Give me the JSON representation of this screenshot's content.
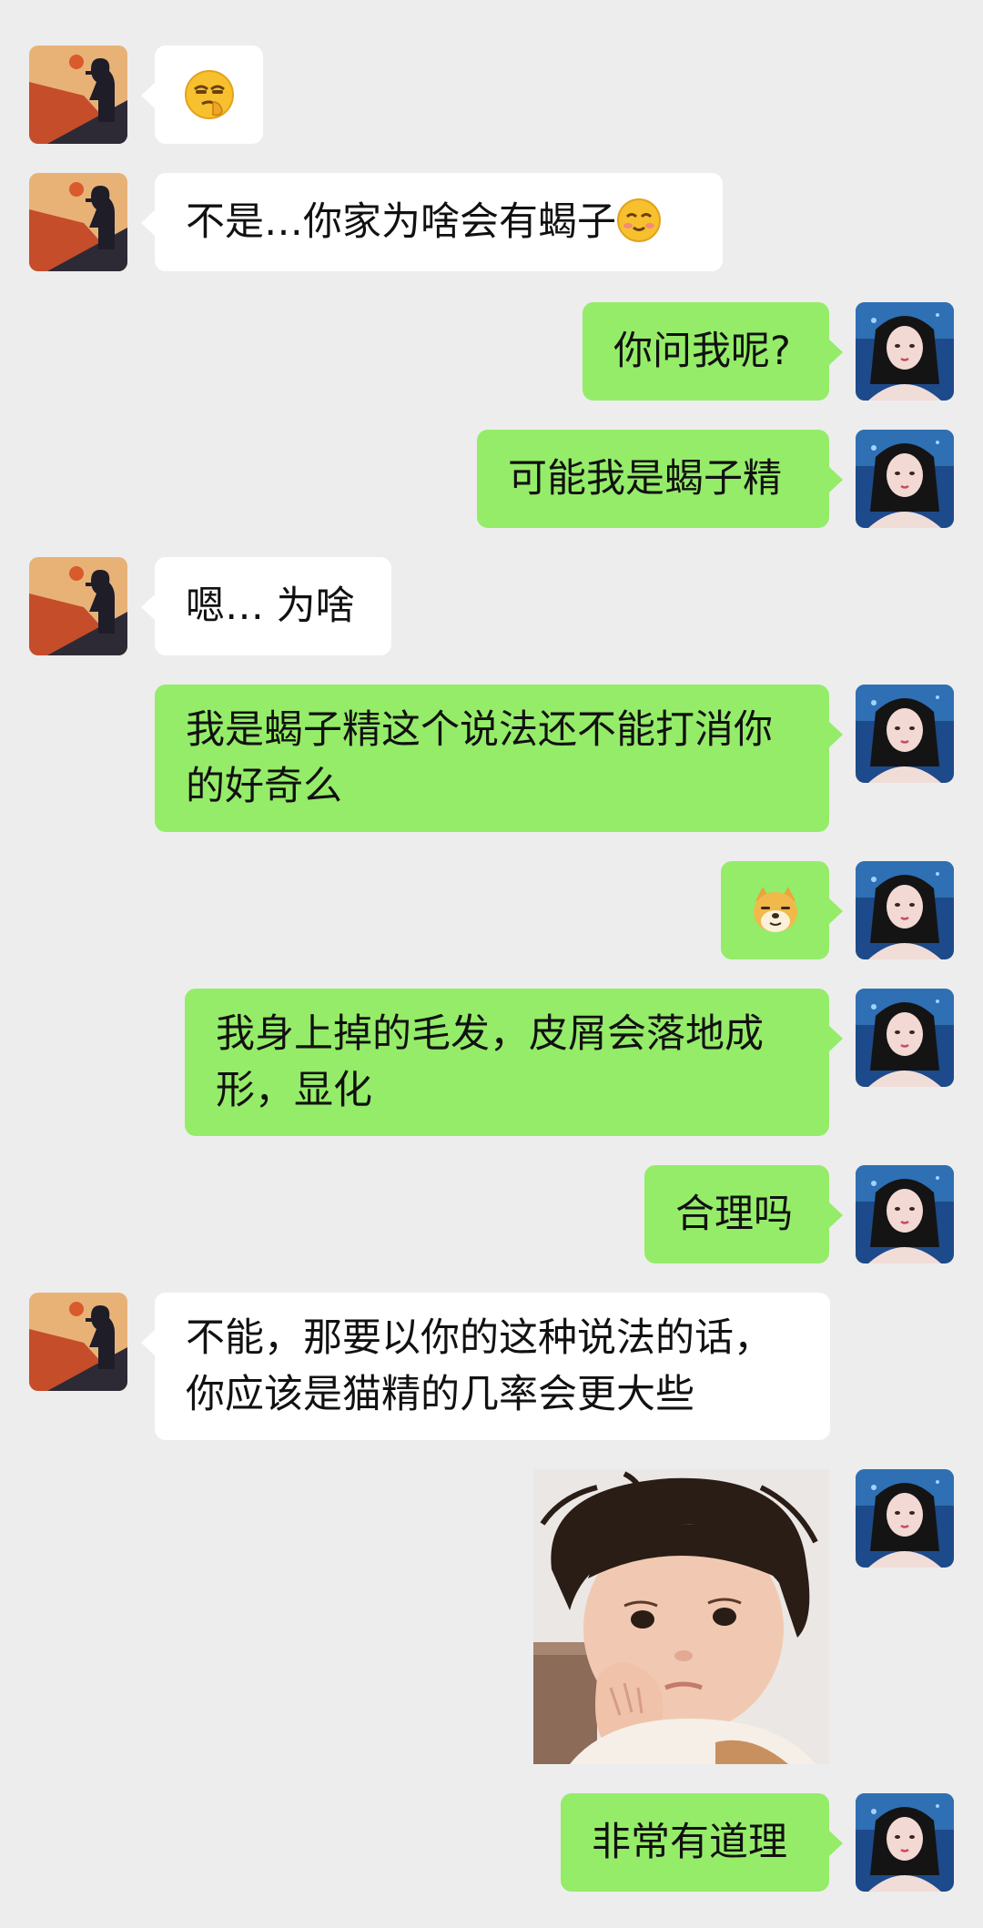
{
  "conversation": {
    "messages": [
      {
        "sender": "friend",
        "type": "emoji",
        "icon": "smirk-shush-emoji"
      },
      {
        "sender": "friend",
        "type": "text",
        "text": "不是…你家为啥会有蝎子",
        "trailing_icon": "blush-smile-emoji"
      },
      {
        "sender": "me",
        "type": "text",
        "text": "你问我呢?"
      },
      {
        "sender": "me",
        "type": "text",
        "text": "可能我是蝎子精"
      },
      {
        "sender": "friend",
        "type": "text",
        "text": "嗯… 为啥"
      },
      {
        "sender": "me",
        "type": "text",
        "text": "我是蝎子精这个说法还不能打消你\n的好奇么"
      },
      {
        "sender": "me",
        "type": "emoji",
        "icon": "doge-emoji"
      },
      {
        "sender": "me",
        "type": "text",
        "text": "我身上掉的毛发，皮屑会落地成\n形，显化"
      },
      {
        "sender": "me",
        "type": "text",
        "text": "合理吗"
      },
      {
        "sender": "friend",
        "type": "text",
        "text": "不能，那要以你的这种说法的话，\n你应该是猫精的几率会更大些"
      },
      {
        "sender": "me",
        "type": "sticker",
        "description": "child-sticker"
      },
      {
        "sender": "me",
        "type": "text",
        "text": "非常有道理"
      }
    ]
  },
  "colors": {
    "background": "#ededed",
    "my_bubble": "#95ec69",
    "friend_bubble": "#ffffff",
    "text": "#111111"
  }
}
